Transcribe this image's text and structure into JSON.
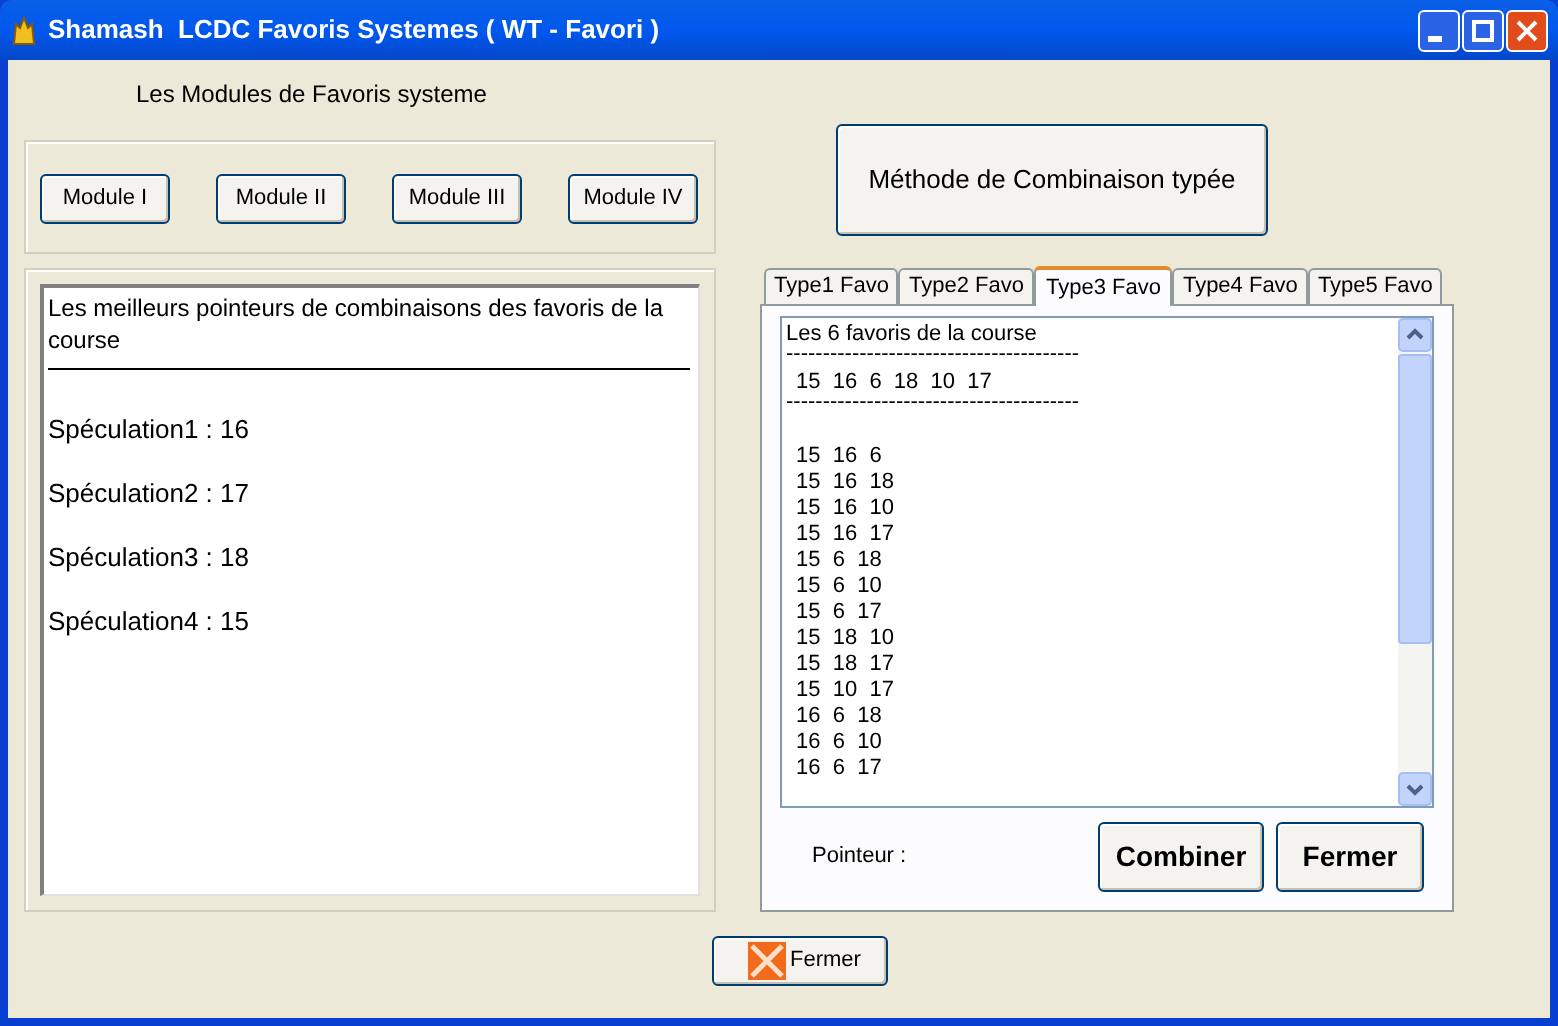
{
  "window": {
    "title": "Shamash  LCDC Favoris Systemes ( WT - Favori )"
  },
  "modules": {
    "heading": "Les Modules de Favoris systeme",
    "buttons": [
      "Module I",
      "Module II",
      "Module III",
      "Module IV"
    ]
  },
  "results": {
    "heading": "Les meilleurs pointeurs de combinaisons des favoris de la course",
    "lines": [
      "Spéculation1 : 16",
      "Spéculation2 : 17",
      "Spéculation3 : 18",
      "Spéculation4 : 15"
    ]
  },
  "method_button": "Méthode de Combinaison typée",
  "tabs": [
    {
      "label": "Type1 Favo",
      "selected": false
    },
    {
      "label": "Type2 Favo",
      "selected": false
    },
    {
      "label": "Type3 Favo",
      "selected": true
    },
    {
      "label": "Type4 Favo",
      "selected": false
    },
    {
      "label": "Type5 Favo",
      "selected": false
    }
  ],
  "list": {
    "title": "Les 6 favoris de la course",
    "separator_top": "----------------------------------------",
    "favorites": "15  16  6  18  10  17",
    "separator_bottom": "----------------------------------------",
    "combinations": [
      "15  16  6",
      "15  16  18",
      "15  16  10",
      "15  16  17",
      "15  6  18",
      "15  6  10",
      "15  6  17",
      "15  18  10",
      "15  18  17",
      "15  10  17",
      "16  6  18",
      "16  6  10",
      "16  6  17"
    ]
  },
  "pointer_label": "Pointeur :",
  "combine_button": "Combiner",
  "close_button": "Fermer",
  "footer_button": "Fermer"
}
